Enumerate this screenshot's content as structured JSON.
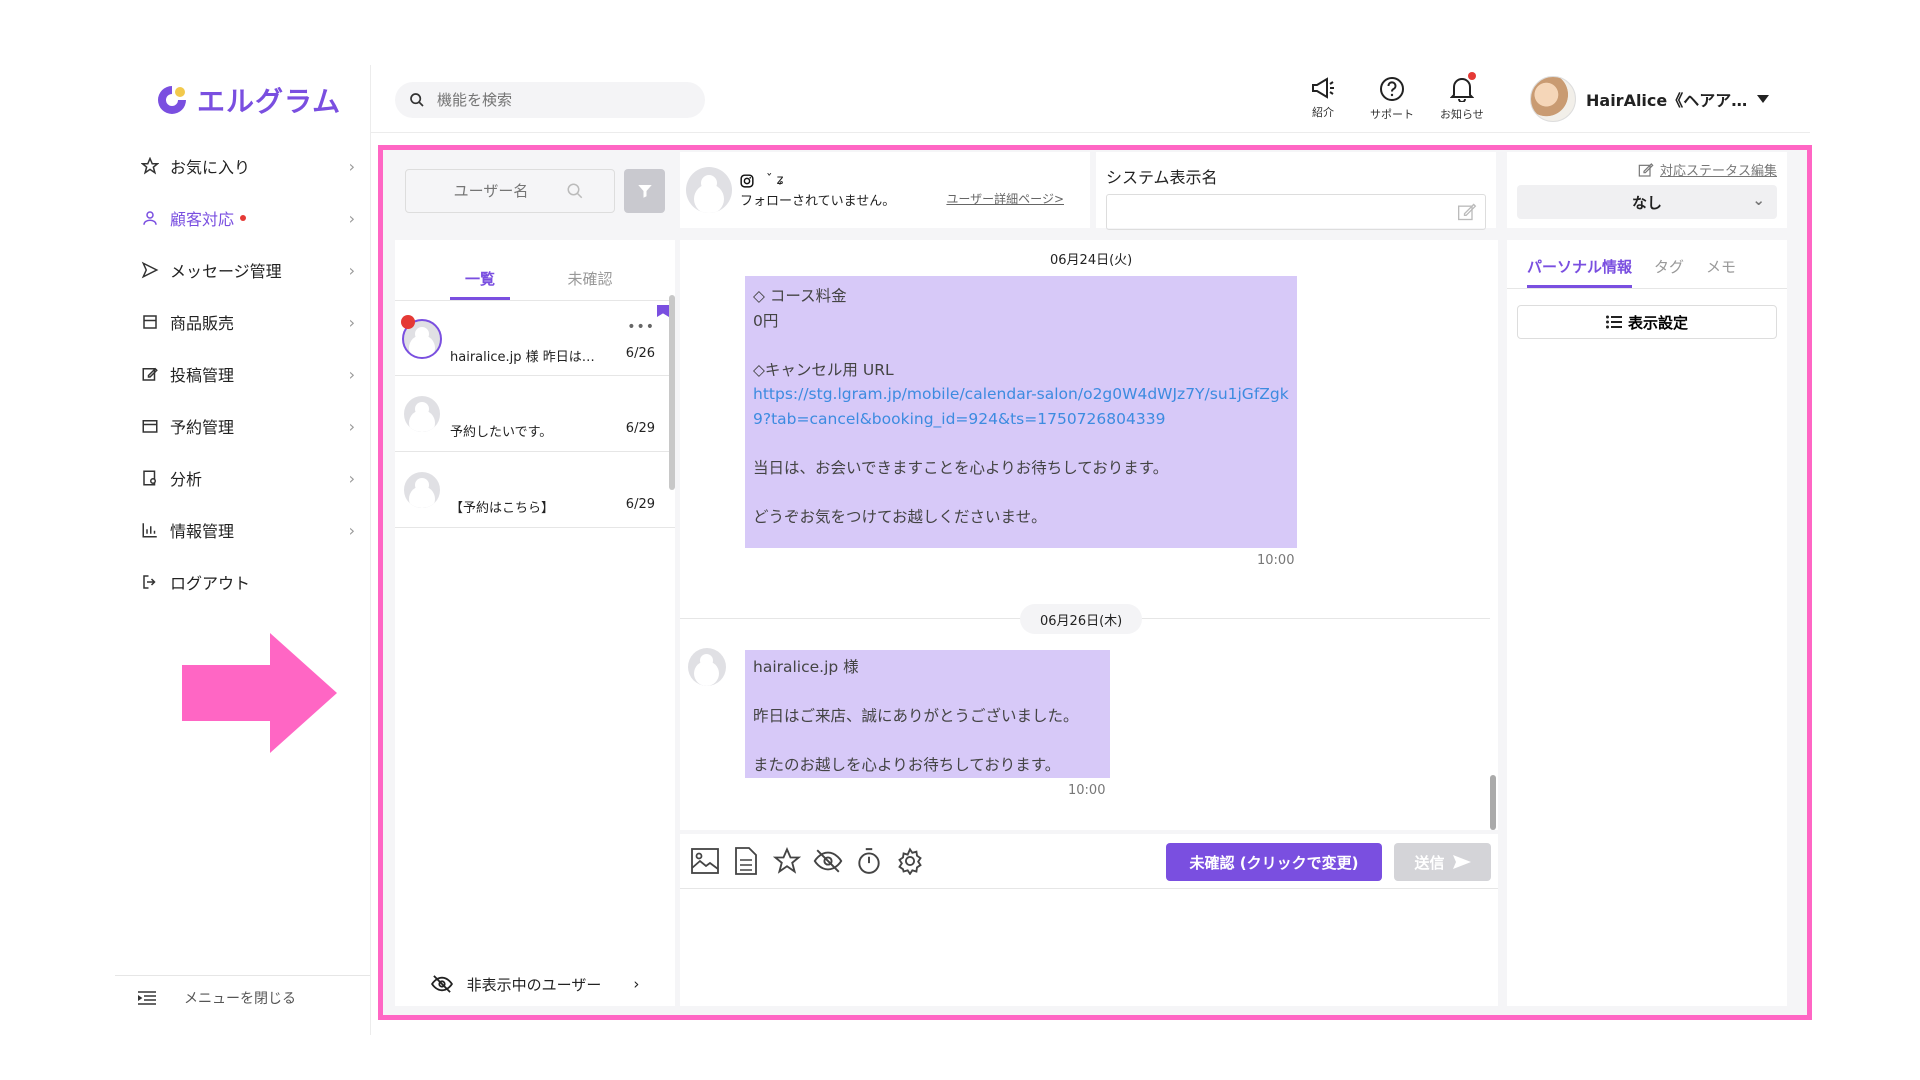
{
  "app": {
    "logo_text": "エルグラム"
  },
  "sidebar": {
    "items": [
      {
        "label": "お気に入り"
      },
      {
        "label": "顧客対応"
      },
      {
        "label": "メッセージ管理"
      },
      {
        "label": "商品販売"
      },
      {
        "label": "投稿管理"
      },
      {
        "label": "予約管理"
      },
      {
        "label": "分析"
      },
      {
        "label": "情報管理"
      },
      {
        "label": "ログアウト"
      }
    ],
    "close_label": "メニューを閉じる"
  },
  "header": {
    "search_placeholder": "機能を検索",
    "intro_label": "紹介",
    "support_label": "サポート",
    "notify_label": "お知らせ",
    "user_name": "HairAlice《ヘアア…"
  },
  "user_list": {
    "search_placeholder": "ユーザー名",
    "tabs": [
      "一覧",
      "未確認"
    ],
    "conversations": [
      {
        "text": "hairalice.jp 様 昨日は…",
        "date": "6/26"
      },
      {
        "text": "予約したいです。",
        "date": "6/29"
      },
      {
        "text": "【予約はこちら】",
        "date": "6/29"
      }
    ],
    "hidden_label": "非表示中のユーザー"
  },
  "profile": {
    "name": "ˇ ʑ",
    "follow_status": "フォローされていません。",
    "detail_link": "ユーザー詳細ページ>"
  },
  "system_name": {
    "label": "システム表示名",
    "value": ""
  },
  "status": {
    "edit_label": "対応ステータス編集",
    "value": "なし"
  },
  "chat": {
    "date1": "06月24日(火)",
    "msg1_lines": [
      "◇ コース料金",
      "0円",
      "",
      "◇キャンセル用 URL",
      "https://stg.lgram.jp/mobile/calendar-salon/o2g0W4dWJz7Y/su1jGfZgk",
      "9?tab=cancel&booking_id=924&ts=1750726804339",
      "",
      "当日は、お会いできますことを心よりお待ちしております。",
      "",
      "どうぞお気をつけてお越しくださいませ。"
    ],
    "msg1_time": "10:00",
    "date2": "06月26日(木)",
    "msg2_lines": [
      "hairalice.jp 様",
      "",
      "昨日はご来店、誠にありがとうございました。",
      "",
      "またのお越しを心よりお待ちしております。"
    ],
    "msg2_time": "10:00"
  },
  "compose": {
    "unread_button": "未確認 (クリックで変更)",
    "send_button": "送信"
  },
  "right_panel": {
    "tabs": [
      "パーソナル情報",
      "タグ",
      "メモ"
    ],
    "display_settings": "表示設定"
  },
  "colors": {
    "accent": "#7a4fe0",
    "frame": "#ff66c4",
    "bubble": "#d7c9f8",
    "alert": "#e53935"
  }
}
